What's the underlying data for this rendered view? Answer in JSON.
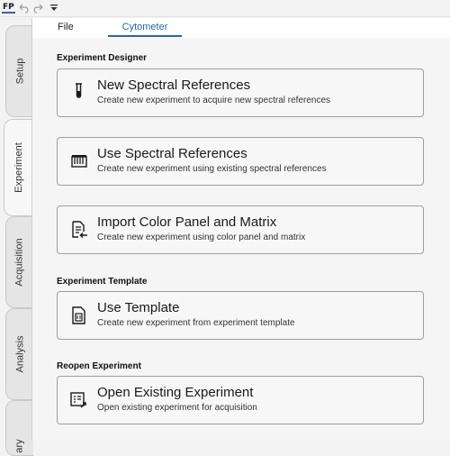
{
  "app": {
    "logo_text": "FP"
  },
  "side_tabs": [
    {
      "label": "Setup"
    },
    {
      "label": "Experiment"
    },
    {
      "label": "Acquisition"
    },
    {
      "label": "Analysis"
    },
    {
      "label": "ary"
    }
  ],
  "ribbon": {
    "tabs": [
      {
        "label": "File"
      },
      {
        "label": "Cytometer"
      }
    ],
    "active_tab": "Cytometer"
  },
  "sections": {
    "designer": "Experiment Designer",
    "template": "Experiment Template",
    "reopen": "Reopen Experiment"
  },
  "cards": {
    "new_spectral": {
      "title": "New Spectral References",
      "desc": "Create new experiment to acquire new spectral references",
      "icon": "test-tube-icon"
    },
    "use_spectral": {
      "title": "Use Spectral References",
      "desc": "Create new experiment using existing spectral references",
      "icon": "spectrum-icon"
    },
    "import_panel": {
      "title": "Import Color Panel and Matrix",
      "desc": "Create new experiment using color panel and matrix",
      "icon": "import-document-icon"
    },
    "use_template": {
      "title": "Use Template",
      "desc": "Create new experiment from experiment template",
      "icon": "template-icon"
    },
    "open_existing": {
      "title": "Open Existing Experiment",
      "desc": "Open existing experiment for acquisition",
      "icon": "open-experiment-icon"
    }
  },
  "colors": {
    "accent": "#1f6aa5",
    "card_border": "#9e9e9e",
    "background": "#f5f5f5"
  }
}
